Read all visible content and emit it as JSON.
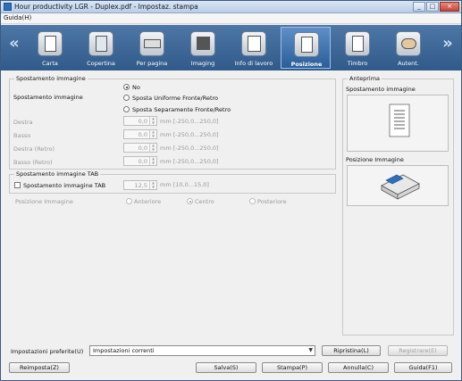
{
  "window": {
    "title": "Hour productivity LGR - Duplex.pdf - Impostaz. stampa",
    "close_glyph": "×",
    "minimize_glyph": "_",
    "maximize_glyph": "□"
  },
  "menu": {
    "guide": "Guida(H)"
  },
  "nav": {
    "prev": "«",
    "next": "»"
  },
  "tabs": [
    {
      "label": "Carta",
      "icon": "paper-icon"
    },
    {
      "label": "Copertina",
      "icon": "cover-icon"
    },
    {
      "label": "Per pagina",
      "icon": "per-page-icon"
    },
    {
      "label": "Imaging",
      "icon": "imaging-icon"
    },
    {
      "label": "Info di lavoro",
      "icon": "job-info-icon"
    },
    {
      "label": "Posizione",
      "icon": "position-icon",
      "active": true
    },
    {
      "label": "Timbro",
      "icon": "stamp-icon"
    },
    {
      "label": "Autent.",
      "icon": "authentication-icon"
    }
  ],
  "shift": {
    "group_title": "Spostamento immagine",
    "label": "Spostamento immagine",
    "options": [
      "No",
      "Sposta Uniforme Fronte/Retro",
      "Sposta Separamente Fronte/Retro"
    ],
    "selected": "No",
    "fields": [
      {
        "label": "Destra",
        "value": "0,0",
        "range": "mm [-250,0...250,0]"
      },
      {
        "label": "Basso",
        "value": "0,0",
        "range": "mm [-250,0...250,0]"
      },
      {
        "label": "Destra (Retro)",
        "value": "0,0",
        "range": "mm [-250,0...250,0]"
      },
      {
        "label": "Basso (Retro)",
        "value": "0,0",
        "range": "mm [-250,0...250,0]"
      }
    ]
  },
  "tab_shift": {
    "group_title": "Spostamento immagine TAB",
    "checkbox_label": "Spostamento immagine TAB",
    "checked": false,
    "value": "12,5",
    "range": "mm [10,0...15,0]",
    "position_label": "Posizione Immagine",
    "positions": [
      "Anteriore",
      "Centro",
      "Posteriore"
    ],
    "position_selected": "Centro"
  },
  "preview": {
    "group_title": "Anteprima",
    "shift_label": "Spostamento immagine",
    "position_label": "Posizione Immagine"
  },
  "bottom": {
    "favorites_label": "Impostazioni preferite(U)",
    "favorites_value": "Impostazioni correnti",
    "restore": "Ripristina(L)",
    "register": "Registrare(E)",
    "reset": "Reimposta(Z)",
    "save": "Salva(S)",
    "print": "Stampa(P)",
    "cancel": "Annulla(C)",
    "help": "Guida(F1)"
  }
}
